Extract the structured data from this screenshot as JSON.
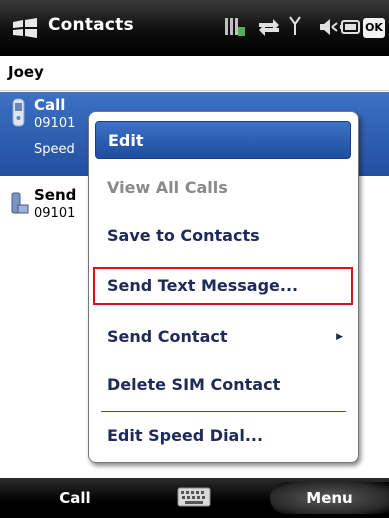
{
  "titlebar": {
    "app_title": "Contacts",
    "ok_label": "OK",
    "icons": [
      "windows-start-icon",
      "signal-battery-icon",
      "data-arrows-icon",
      "antenna-icon",
      "speaker-icon",
      "battery-icon"
    ]
  },
  "header": {
    "contact_name": "Joey"
  },
  "list": {
    "items": [
      {
        "title": "Call",
        "number": "09101",
        "extra": "Speed",
        "selected": true,
        "icon": "phone-icon"
      },
      {
        "title": "Send",
        "number": "09101",
        "selected": false,
        "icon": "sms-icon"
      }
    ]
  },
  "context_menu": {
    "items": [
      {
        "label": "Edit",
        "state": "highlighted"
      },
      {
        "label": "View All Calls",
        "state": "disabled"
      },
      {
        "label": "Save to Contacts",
        "state": "normal"
      },
      {
        "label": "Send Text Message...",
        "state": "boxed"
      },
      {
        "label": "Send Contact",
        "state": "submenu"
      },
      {
        "label": "Delete SIM Contact",
        "state": "normal"
      },
      {
        "label": "Edit Speed Dial...",
        "state": "normal"
      }
    ],
    "highlight_color": "#2f63b8",
    "annotation_color": "#e0101a"
  },
  "softkeys": {
    "left": "Call",
    "right": "Menu",
    "center_icon": "keyboard-icon"
  }
}
